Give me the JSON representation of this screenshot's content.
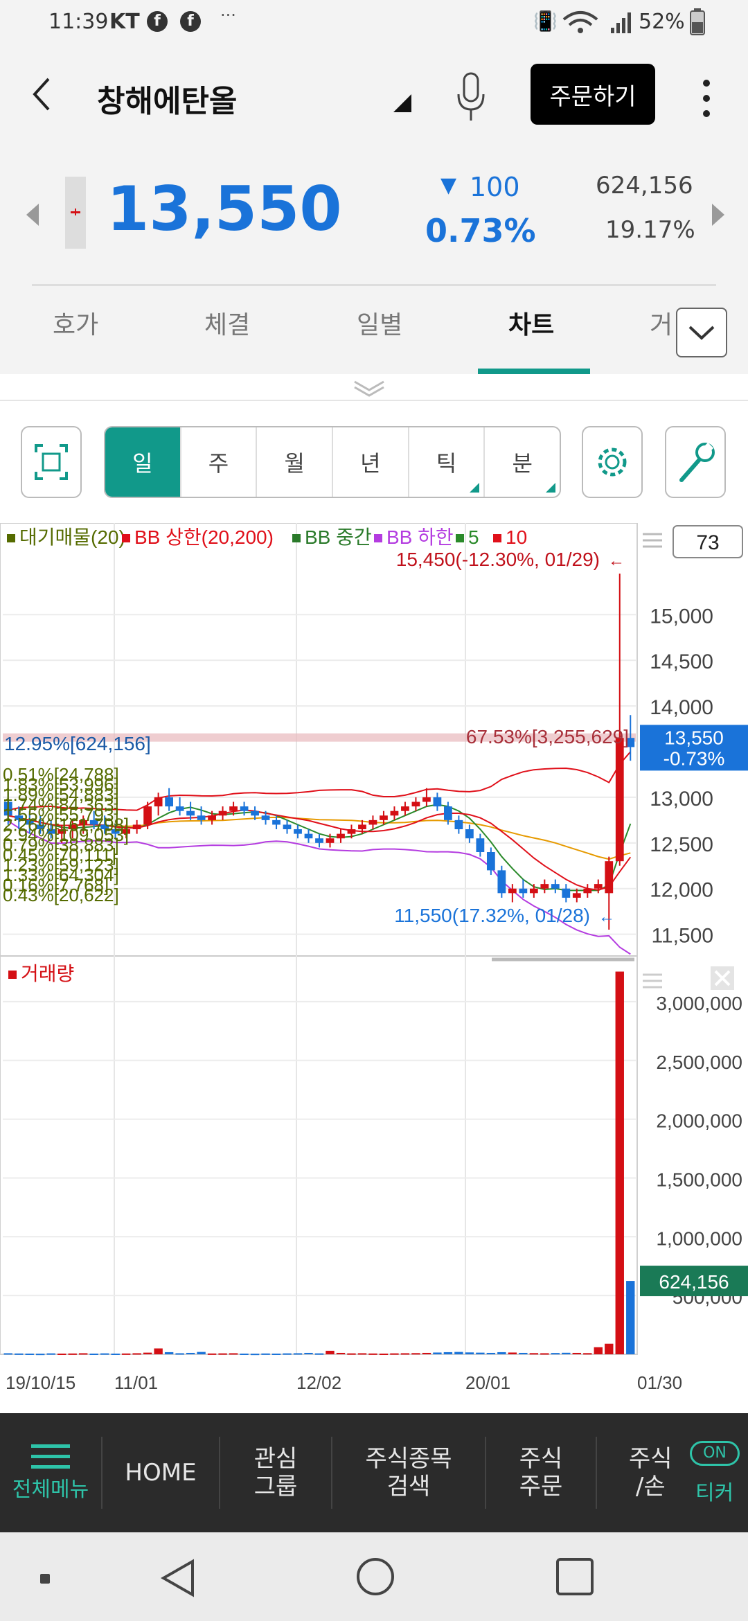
{
  "status_bar": {
    "time": "11:39",
    "carrier": "KT",
    "battery": "52%"
  },
  "header": {
    "title": "창해에탄올",
    "order_button": "주문하기"
  },
  "quote": {
    "price": "13,550",
    "change_symbol": "▼",
    "change": "100",
    "change_pct": "0.73%",
    "volume": "624,156",
    "turnover_pct": "19.17%"
  },
  "tabs": [
    "호가",
    "체결",
    "일별",
    "차트",
    "거"
  ],
  "active_tab": "차트",
  "period_buttons": [
    "일",
    "주",
    "월",
    "년",
    "틱",
    "분"
  ],
  "active_period": "일",
  "chart_data": {
    "type": "candlestick",
    "legend": [
      {
        "label": "대기매물(20)",
        "color": "#556b00"
      },
      {
        "label": "BB 상한(20,200)",
        "color": "#e0101a"
      },
      {
        "label": "BB 중간",
        "color": "#2a7a2a"
      },
      {
        "label": "BB 하한",
        "color": "#b43ce0"
      },
      {
        "label": "5",
        "color": "#2a8a2a"
      },
      {
        "label": "10",
        "color": "#e0101a"
      }
    ],
    "visible_count": "73",
    "price_axis_ticks": [
      15000,
      14500,
      14000,
      13000,
      12500,
      12000,
      11500
    ],
    "price_range": [
      11300,
      15700
    ],
    "current_price_label": "13,550",
    "current_change_label": "-0.73%",
    "high_annotation": "15,450(-12.30%, 01/29)",
    "low_annotation": "11,550(17.32%, 01/28)",
    "left_volume_label": "12.95%[624,156]",
    "right_volume_label": "67.53%[3,255,629]",
    "volume_profile_labels": [
      "0.51%[24,788]",
      "1.83%[53,996]",
      "1.89%[54,883]",
      "1.74%[84,363]",
      "1.55%[55,793]",
      "2.26%[161,798]",
      "2.94%[109,053]",
      "0.79%[38,883]",
      "0.45%[70,111]",
      "1.23%[59,123]",
      "1.33%[64,304]",
      "0.16%[7,768]",
      "0.43%[20,622]"
    ],
    "volume_title": "거래량",
    "volume_axis_ticks": [
      3000000,
      2500000,
      2000000,
      1500000,
      1000000,
      500000
    ],
    "volume_range": [
      0,
      3300000
    ],
    "current_volume_label": "624,156",
    "x_labels": [
      "19/10/15",
      "11/01",
      "12/02",
      "20/01",
      "01/30"
    ],
    "candles": [
      [
        12950,
        13050,
        12700,
        12800
      ],
      [
        12800,
        12900,
        12650,
        12750
      ],
      [
        12750,
        12850,
        12600,
        12700
      ],
      [
        12700,
        12800,
        12600,
        12650
      ],
      [
        12650,
        12750,
        12550,
        12600
      ],
      [
        12600,
        12700,
        12500,
        12650
      ],
      [
        12650,
        12750,
        12550,
        12700
      ],
      [
        12700,
        12800,
        12600,
        12750
      ],
      [
        12750,
        12850,
        12650,
        12700
      ],
      [
        12700,
        12800,
        12600,
        12650
      ],
      [
        12650,
        12700,
        12550,
        12600
      ],
      [
        12600,
        12700,
        12550,
        12650
      ],
      [
        12650,
        12750,
        12600,
        12700
      ],
      [
        12700,
        12950,
        12650,
        12900
      ],
      [
        12900,
        13050,
        12800,
        13000
      ],
      [
        13000,
        13100,
        12850,
        12900
      ],
      [
        12900,
        13000,
        12800,
        12850
      ],
      [
        12850,
        12950,
        12750,
        12800
      ],
      [
        12800,
        12900,
        12700,
        12750
      ],
      [
        12750,
        12850,
        12700,
        12800
      ],
      [
        12800,
        12900,
        12750,
        12850
      ],
      [
        12850,
        12950,
        12800,
        12900
      ],
      [
        12900,
        12950,
        12800,
        12850
      ],
      [
        12850,
        12900,
        12750,
        12800
      ],
      [
        12800,
        12850,
        12700,
        12750
      ],
      [
        12750,
        12800,
        12650,
        12700
      ],
      [
        12700,
        12750,
        12600,
        12650
      ],
      [
        12650,
        12700,
        12550,
        12600
      ],
      [
        12600,
        12650,
        12500,
        12550
      ],
      [
        12550,
        12600,
        12450,
        12500
      ],
      [
        12500,
        12600,
        12450,
        12550
      ],
      [
        12550,
        12650,
        12500,
        12600
      ],
      [
        12600,
        12700,
        12550,
        12650
      ],
      [
        12650,
        12750,
        12600,
        12700
      ],
      [
        12700,
        12800,
        12650,
        12750
      ],
      [
        12750,
        12850,
        12700,
        12800
      ],
      [
        12800,
        12900,
        12750,
        12850
      ],
      [
        12850,
        12950,
        12800,
        12900
      ],
      [
        12900,
        13000,
        12850,
        12950
      ],
      [
        12950,
        13100,
        12900,
        13000
      ],
      [
        13000,
        13050,
        12850,
        12900
      ],
      [
        12900,
        12950,
        12700,
        12750
      ],
      [
        12750,
        12800,
        12600,
        12650
      ],
      [
        12650,
        12700,
        12500,
        12550
      ],
      [
        12550,
        12600,
        12350,
        12400
      ],
      [
        12400,
        12450,
        12150,
        12200
      ],
      [
        12200,
        12250,
        11900,
        11950
      ],
      [
        11950,
        12050,
        11850,
        12000
      ],
      [
        12000,
        12100,
        11900,
        11950
      ],
      [
        11950,
        12050,
        11900,
        12000
      ],
      [
        12000,
        12100,
        11950,
        12050
      ],
      [
        12050,
        12100,
        11950,
        12000
      ],
      [
        12000,
        12050,
        11850,
        11900
      ],
      [
        11900,
        12000,
        11850,
        11950
      ],
      [
        11950,
        12050,
        11900,
        12000
      ],
      [
        12000,
        12100,
        11950,
        12050
      ],
      [
        11950,
        12350,
        11550,
        12300
      ],
      [
        12300,
        15450,
        12250,
        13650
      ],
      [
        13650,
        13900,
        13400,
        13550
      ]
    ],
    "volumes": [
      9000,
      7000,
      6000,
      5000,
      8000,
      6000,
      7000,
      9000,
      6000,
      8000,
      6000,
      7000,
      9000,
      14000,
      50000,
      18000,
      9000,
      12000,
      20000,
      7000,
      8000,
      9000,
      6000,
      5000,
      7000,
      6000,
      8000,
      9000,
      12000,
      8000,
      30000,
      12000,
      8000,
      9000,
      7000,
      6000,
      8000,
      9000,
      10000,
      12000,
      15000,
      18000,
      20000,
      16000,
      14000,
      12000,
      18000,
      15000,
      12000,
      10000,
      9000,
      11000,
      13000,
      12000,
      10000,
      60000,
      90000,
      3255629,
      624156
    ]
  },
  "bottom_nav": {
    "menu_label": "전체메뉴",
    "items": [
      "HOME",
      "관심\n그룹",
      "주식종목\n검색",
      "주식\n주문",
      "주식\n/손"
    ],
    "ticker_label": "티커",
    "toggle_label": "ON"
  },
  "colors": {
    "accent": "#11998a",
    "up": "#d40f14",
    "down": "#1a73d9",
    "nav_bg": "#2b2b2b"
  }
}
